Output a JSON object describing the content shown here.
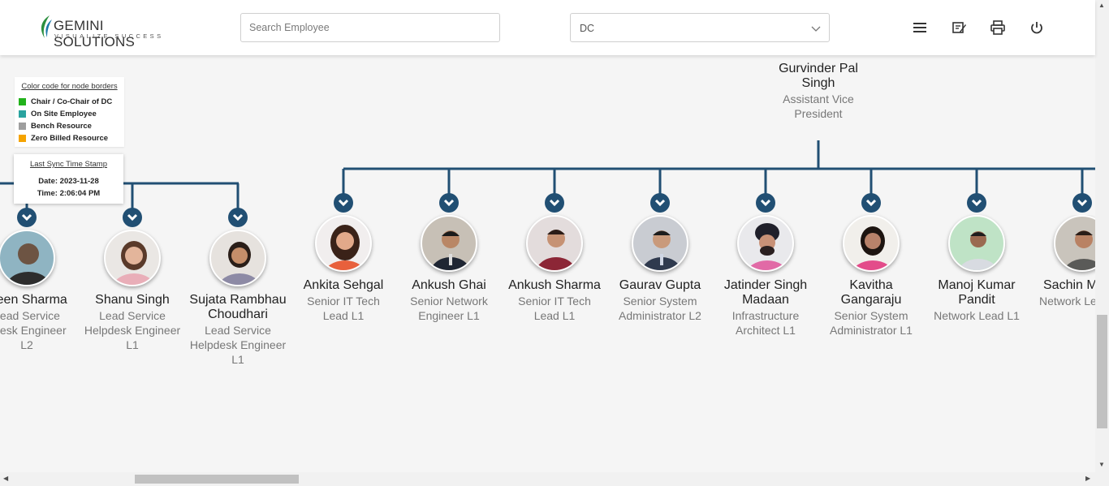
{
  "header": {
    "logo_main": "GEMINI SOLUTIONS",
    "logo_tagline": "VISUALIZE SUCCESS",
    "search_placeholder": "Search Employee",
    "department_value": "DC"
  },
  "legend": {
    "title": "Color code for node borders",
    "items": [
      {
        "label": "Chair / Co-Chair of DC",
        "color": "#22b21b"
      },
      {
        "label": "On Site Employee",
        "color": "#2aa39f"
      },
      {
        "label": "Bench Resource",
        "color": "#9e9e9e"
      },
      {
        "label": "Zero Billed Resource",
        "color": "#f5a300"
      }
    ]
  },
  "sync": {
    "title": "Last Sync Time Stamp",
    "date": "Date: 2023-11-28",
    "time": "Time: 2:06:04 PM"
  },
  "manager": {
    "name_line1": "Gurvinder Pal",
    "name_line2": "Singh",
    "title_line1": "Assistant Vice",
    "title_line2": "President"
  },
  "left_nodes": [
    {
      "name": "aleen Sharma",
      "title_line1": "Lead Service",
      "title_line2": "pdesk Engineer",
      "title_line3": "L2"
    },
    {
      "name": "Shanu Singh",
      "title_line1": "Lead Service",
      "title_line2": "Helpdesk Engineer",
      "title_line3": "L1"
    },
    {
      "name_line1": "Sujata Rambhau",
      "name_line2": "Choudhari",
      "title_line1": "Lead Service",
      "title_line2": "Helpdesk Engineer",
      "title_line3": "L1"
    }
  ],
  "right_nodes": [
    {
      "name": "Ankita Sehgal",
      "title_line1": "Senior IT Tech",
      "title_line2": "Lead L1"
    },
    {
      "name": "Ankush Ghai",
      "title_line1": "Senior Network",
      "title_line2": "Engineer L1"
    },
    {
      "name": "Ankush Sharma",
      "title_line1": "Senior IT Tech",
      "title_line2": "Lead L1"
    },
    {
      "name": "Gaurav Gupta",
      "title_line1": "Senior System",
      "title_line2": "Administrator L2"
    },
    {
      "name_line1": "Jatinder Singh",
      "name_line2": "Madaan",
      "title_line1": "Infrastructure",
      "title_line2": "Architect L1"
    },
    {
      "name_line1": "Kavitha",
      "name_line2": "Gangaraju",
      "title_line1": "Senior System",
      "title_line2": "Administrator L1"
    },
    {
      "name_line1": "Manoj Kumar",
      "name_line2": "Pandit",
      "title_line1": "Network Lead L1"
    },
    {
      "name": "Sachin M",
      "title_line1": "Network Le"
    }
  ],
  "colors": {
    "connector": "#214f73",
    "accent_green": "#22b21b"
  }
}
